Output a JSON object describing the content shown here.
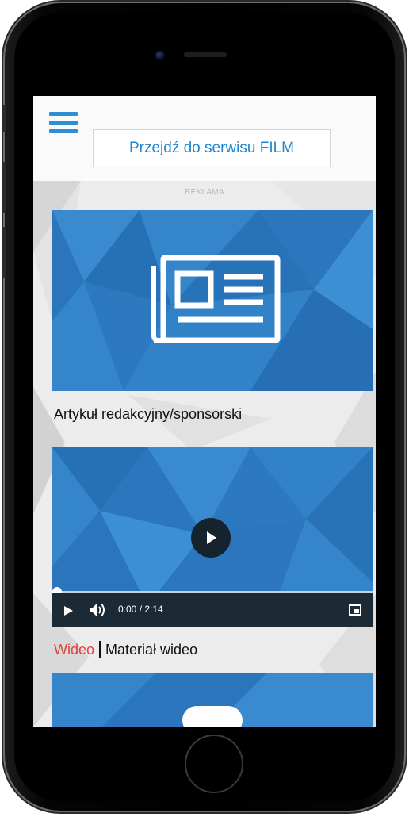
{
  "header": {
    "menu_icon": "hamburger-menu-icon",
    "goto_button_label": "Przejdź do serwisu FILM"
  },
  "ad": {
    "label": "REKLAMA"
  },
  "article": {
    "icon": "newspaper-icon",
    "caption": "Artykuł redakcyjny/sponsorski"
  },
  "video": {
    "player": {
      "time_display": "0:00 / 2:14",
      "progress": 0,
      "play_icon": "play-icon",
      "volume_icon": "volume-icon",
      "fullscreen_icon": "fullscreen-icon"
    },
    "caption_tag": "Wideo",
    "caption_text": "Materiał wideo"
  },
  "colors": {
    "accent_blue": "#1f87d1",
    "card_blue": "#2f7bc1",
    "tag_red": "#e0433b",
    "player_bar": "#1c2a36"
  }
}
